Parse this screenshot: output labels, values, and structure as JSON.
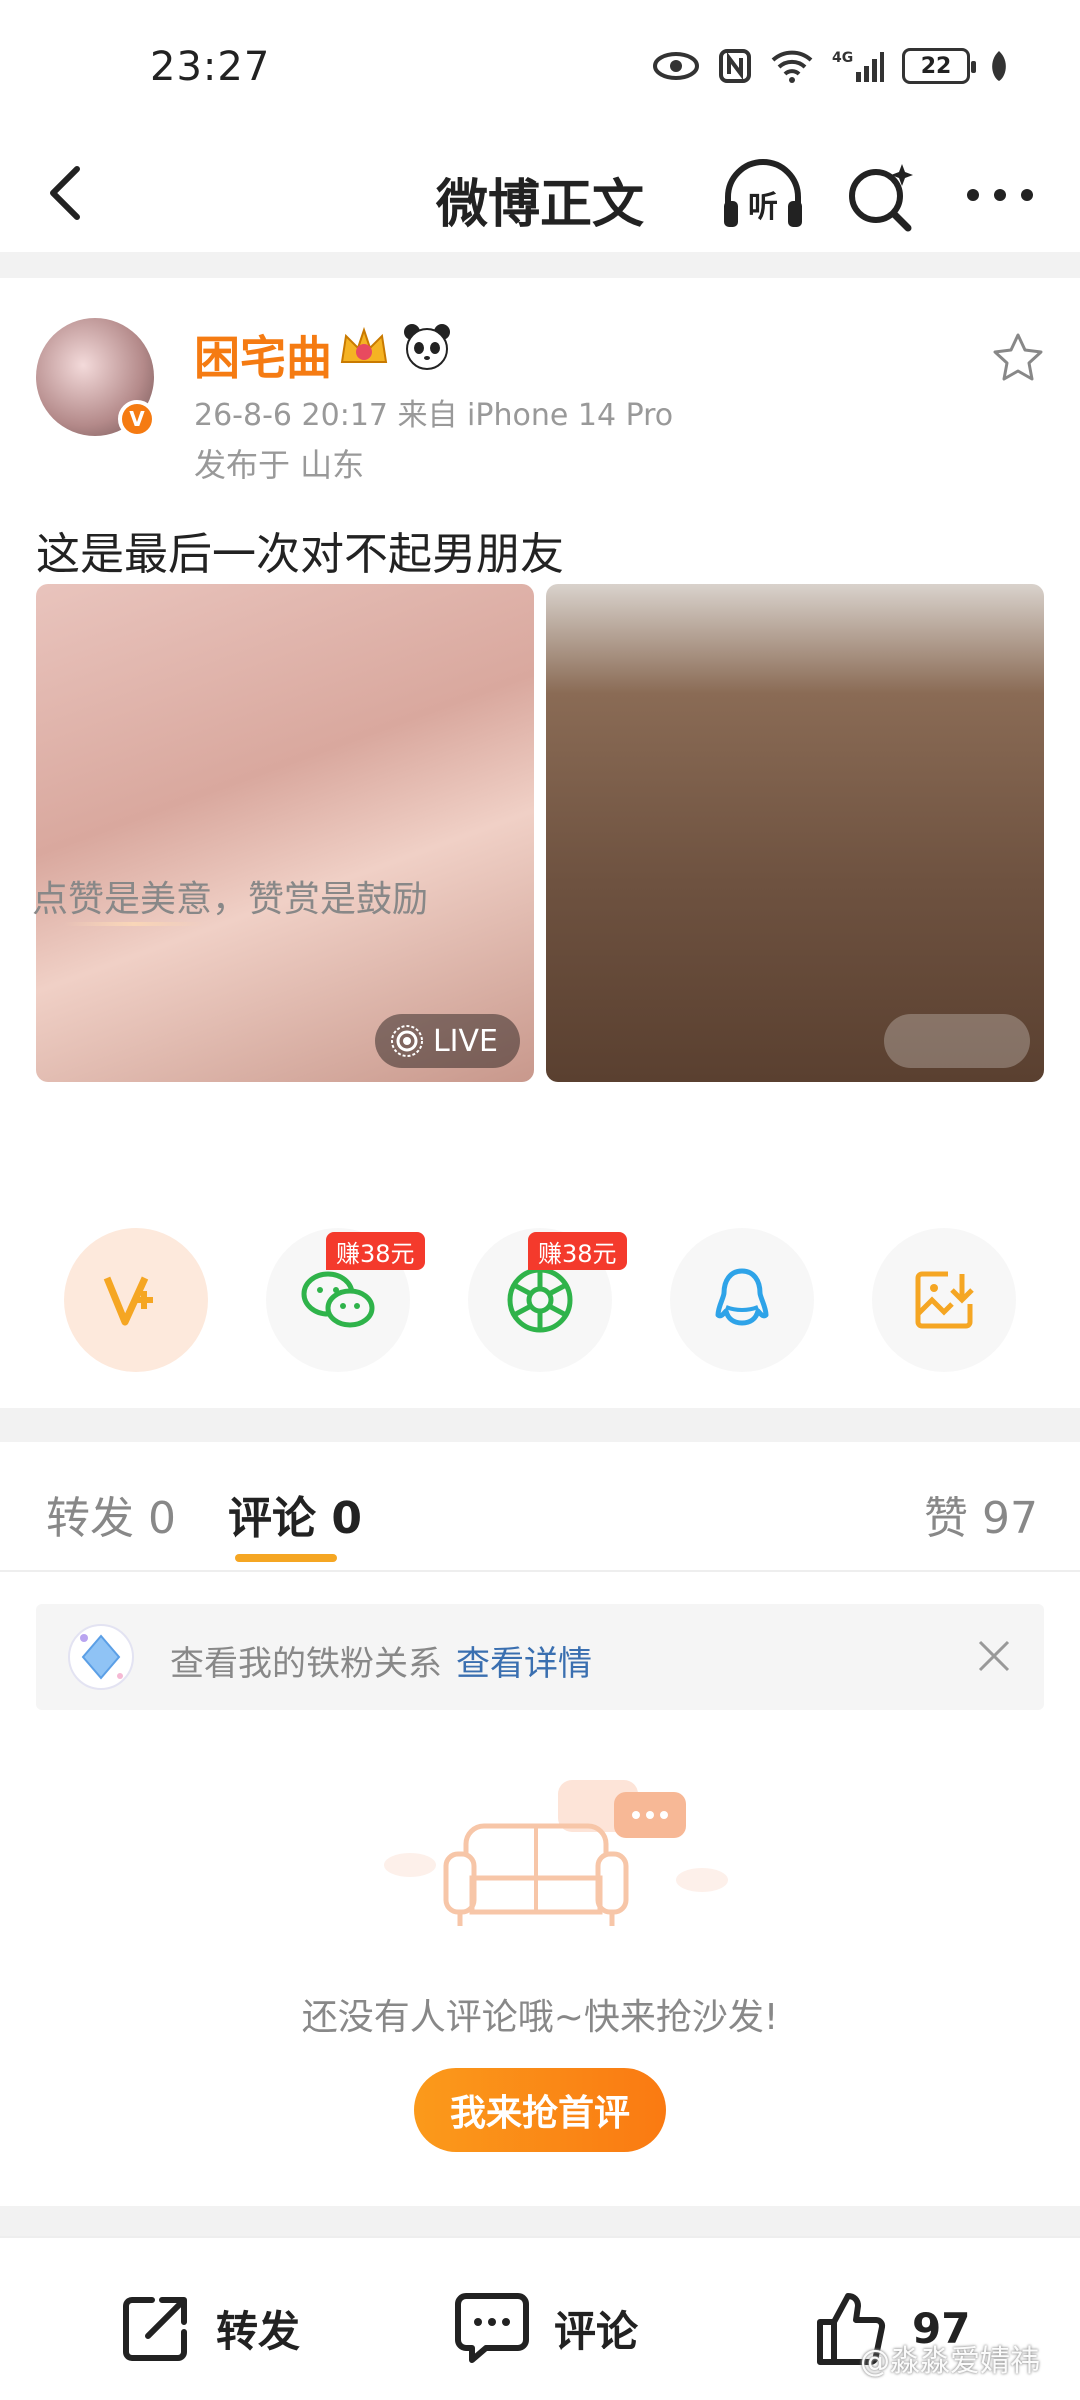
{
  "status_bar": {
    "time": "23:27",
    "battery": "22"
  },
  "nav": {
    "title": "微博正文",
    "listen_label": "听"
  },
  "post": {
    "username": "困宅曲",
    "meta": "26-8-6 20:17  来自 iPhone 14 Pro",
    "location": "发布于 山东",
    "text": "这是最后一次对不起男朋友",
    "live_label": "LIVE"
  },
  "reward": {
    "text": "点赞是美意，赞赏是鼓励"
  },
  "share": {
    "earn_tag_1": "赚38元",
    "earn_tag_2": "赚38元",
    "items": [
      "vip-icon",
      "wechat-icon",
      "moments-icon",
      "qq-icon",
      "save-image-icon"
    ]
  },
  "tabs": {
    "repost": "转发 0",
    "comment": "评论 0",
    "like": "赞 97"
  },
  "fans_banner": {
    "text": "查看我的铁粉关系",
    "link": "查看详情"
  },
  "empty": {
    "text": "还没有人评论哦~快来抢沙发!",
    "button": "我来抢首评"
  },
  "bottom_bar": {
    "repost": "转发",
    "comment": "评论",
    "like_count": "97"
  },
  "watermark": "@淼淼爱婧祎",
  "colors": {
    "accent": "#f57b12",
    "tab_underline": "#f5a623",
    "link": "#3a6fb0"
  }
}
